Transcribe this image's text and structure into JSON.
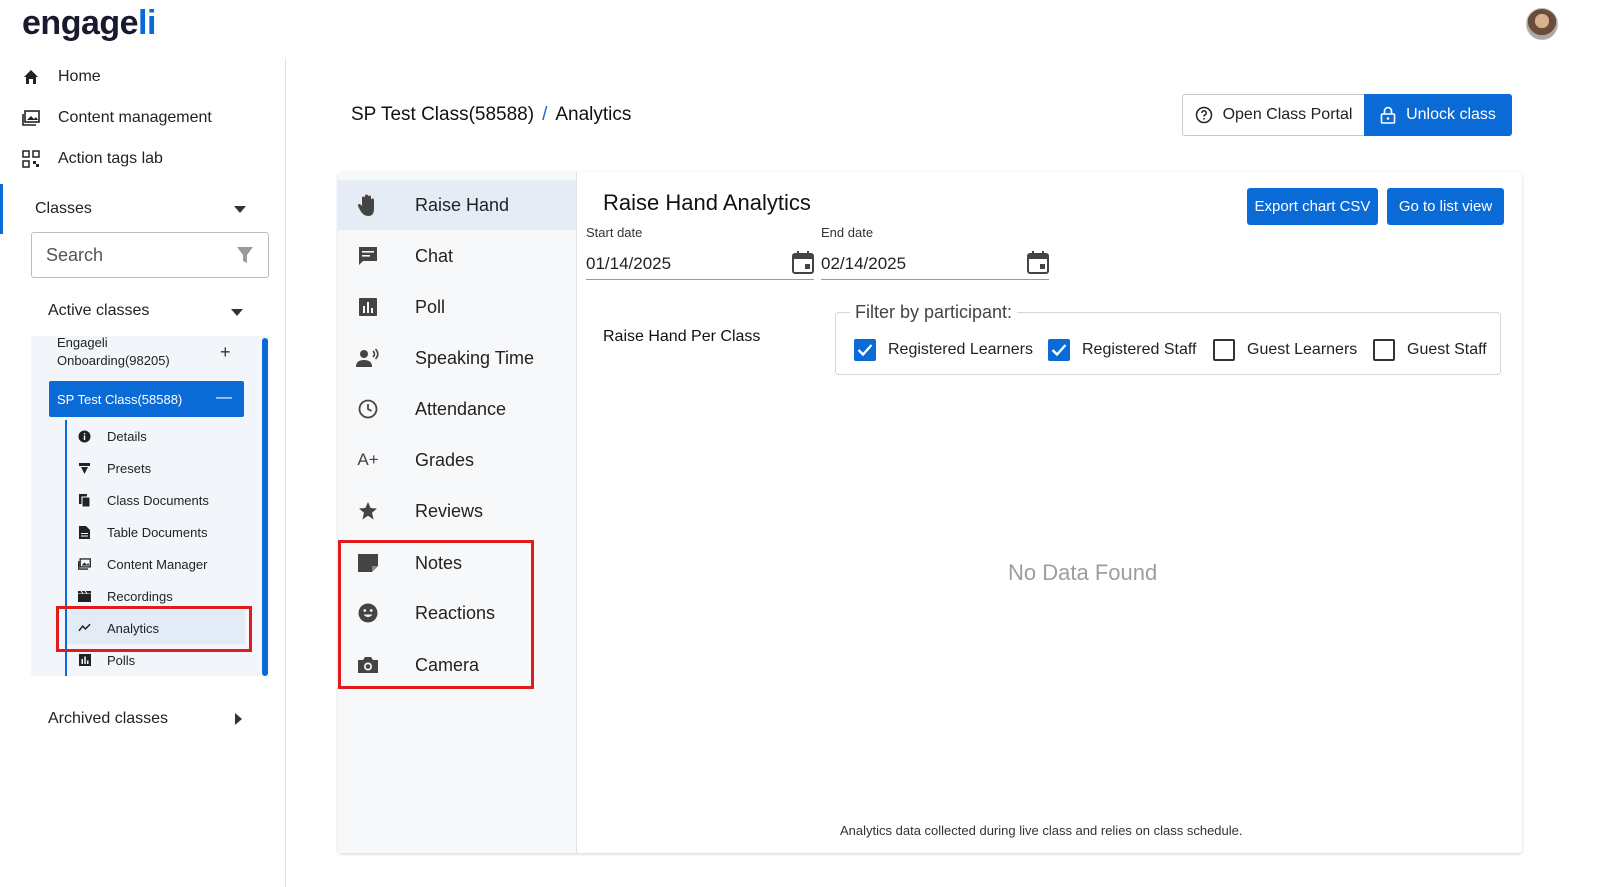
{
  "brand": {
    "logo_prefix": "e",
    "logo_mid": "ngage",
    "logo_suffix": "li"
  },
  "sidebar": {
    "nav": [
      {
        "label": "Home"
      },
      {
        "label": "Content management"
      },
      {
        "label": "Action tags lab"
      }
    ],
    "classes_label": "Classes",
    "search_placeholder": "Search",
    "active_classes_label": "Active classes",
    "onboarding_class": "Engageli Onboarding(98205)",
    "selected_class": "SP Test Class(58588)",
    "sub_items": [
      {
        "label": "Details"
      },
      {
        "label": "Presets"
      },
      {
        "label": "Class Documents"
      },
      {
        "label": "Table Documents"
      },
      {
        "label": "Content Manager"
      },
      {
        "label": "Recordings"
      },
      {
        "label": "Analytics"
      },
      {
        "label": "Polls"
      }
    ],
    "archived_label": "Archived classes"
  },
  "header": {
    "breadcrumb_class": "SP Test Class(58588)",
    "breadcrumb_sep": "/",
    "breadcrumb_page": "Analytics",
    "open_portal_label": "Open Class Portal",
    "unlock_label": "Unlock class"
  },
  "analytics_menu": [
    {
      "label": "Raise Hand",
      "icon": "hand-icon"
    },
    {
      "label": "Chat",
      "icon": "chat-icon"
    },
    {
      "label": "Poll",
      "icon": "poll-icon"
    },
    {
      "label": "Speaking Time",
      "icon": "speaking-icon"
    },
    {
      "label": "Attendance",
      "icon": "clock-icon"
    },
    {
      "label": "Grades",
      "icon": "grade-icon"
    },
    {
      "label": "Reviews",
      "icon": "star-icon"
    },
    {
      "label": "Notes",
      "icon": "note-icon"
    },
    {
      "label": "Reactions",
      "icon": "smiley-icon"
    },
    {
      "label": "Camera",
      "icon": "camera-icon"
    }
  ],
  "content": {
    "title": "Raise Hand Analytics",
    "export_label": "Export chart CSV",
    "list_view_label": "Go to list view",
    "start_date_label": "Start date",
    "start_date": "01/14/2025",
    "end_date_label": "End date",
    "end_date": "02/14/2025",
    "per_class_label": "Raise Hand Per Class",
    "filter_legend": "Filter by participant:",
    "filters": [
      {
        "label": "Registered Learners",
        "checked": true
      },
      {
        "label": "Registered Staff",
        "checked": true
      },
      {
        "label": "Guest Learners",
        "checked": false
      },
      {
        "label": "Guest Staff",
        "checked": false
      }
    ],
    "no_data": "No Data Found",
    "footnote": "Analytics data collected during live class and relies on class schedule."
  },
  "colors": {
    "accent": "#0a6bd6",
    "highlight": "#e01b1b"
  }
}
